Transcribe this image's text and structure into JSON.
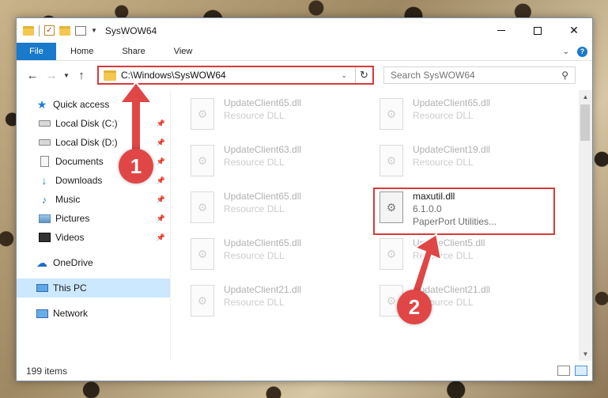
{
  "window": {
    "title": "SysWOW64"
  },
  "ribbon": {
    "file_tab": "File",
    "tabs": [
      "Home",
      "Share",
      "View"
    ]
  },
  "navbar": {
    "address": "C:\\Windows\\SysWOW64",
    "search_placeholder": "Search SysWOW64"
  },
  "sidebar": {
    "quick_access": "Quick access",
    "items": [
      {
        "label": "Local Disk (C:)",
        "icon": "drive-icon"
      },
      {
        "label": "Local Disk (D:)",
        "icon": "drive-icon"
      },
      {
        "label": "Documents",
        "icon": "documents-icon"
      },
      {
        "label": "Downloads",
        "icon": "downloads-icon"
      },
      {
        "label": "Music",
        "icon": "music-icon"
      },
      {
        "label": "Pictures",
        "icon": "pictures-icon"
      },
      {
        "label": "Videos",
        "icon": "videos-icon"
      }
    ],
    "onedrive": "OneDrive",
    "this_pc": "This PC",
    "network": "Network"
  },
  "files": [
    {
      "name": "UpdateClient65.dll",
      "type": "Resource DLL"
    },
    {
      "name": "UpdateClient65.dll",
      "type": "Resource DLL"
    },
    {
      "name": "UpdateClient63.dll",
      "type": "Resource DLL"
    },
    {
      "name": "UpdateClient19.dll",
      "type": "Resource DLL"
    },
    {
      "name": "UpdateClient65.dll",
      "type": "Resource DLL"
    },
    {
      "name": "maxutil.dll",
      "version": "6.1.0.0",
      "type": "PaperPort Utilities..."
    },
    {
      "name": "UpdateClient65.dll",
      "type": "Resource DLL"
    },
    {
      "name": "UpdateClient5.dll",
      "type": "Resource DLL"
    },
    {
      "name": "UpdateClient21.dll",
      "type": "Resource DLL"
    },
    {
      "name": "UpdateClient21.dll",
      "type": "Resource DLL"
    }
  ],
  "status": {
    "count": "199 items"
  },
  "annotations": {
    "step1": "1",
    "step2": "2",
    "color": "#e04646"
  },
  "colors": {
    "accent": "#1979ca",
    "highlight": "#d9393b",
    "selection": "#cce8ff"
  }
}
